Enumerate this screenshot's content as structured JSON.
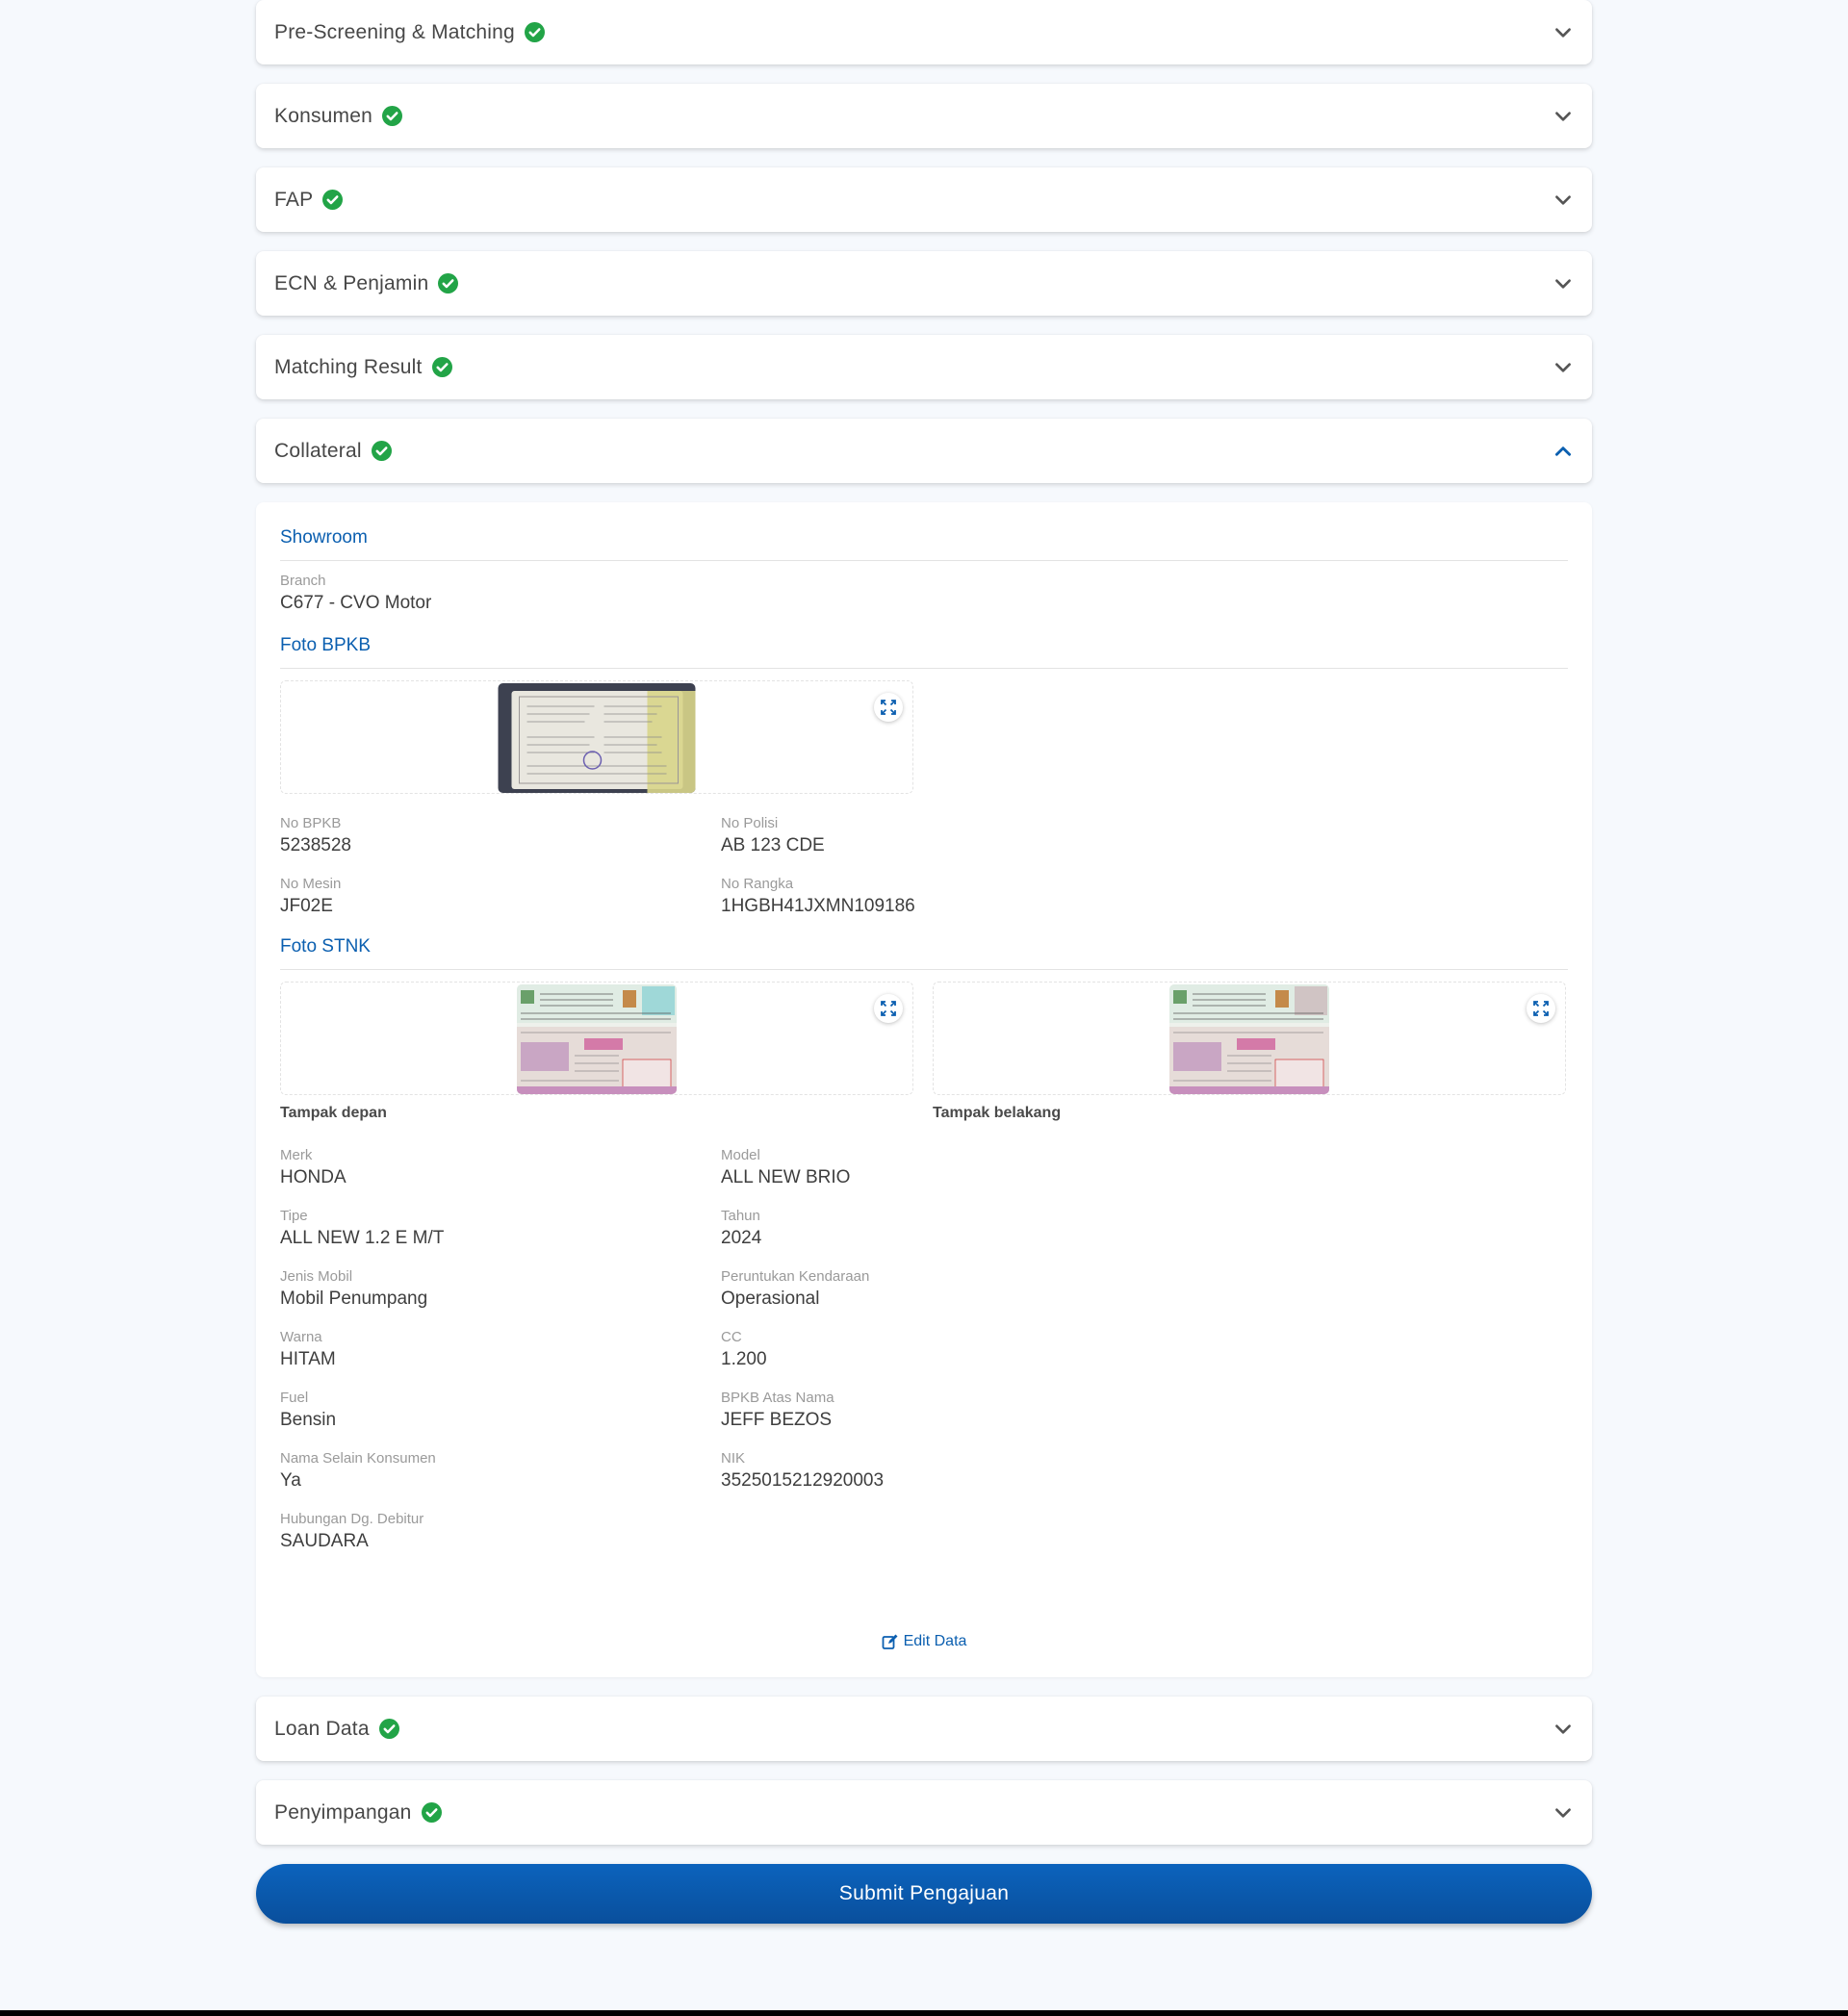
{
  "sections": {
    "prescreening": "Pre-Screening & Matching",
    "konsumen": "Konsumen",
    "fap": "FAP",
    "ecn": "ECN & Penjamin",
    "matching": "Matching Result",
    "collateral": "Collateral",
    "loan": "Loan Data",
    "penyimpangan": "Penyimpangan"
  },
  "collateral": {
    "showroom_title": "Showroom",
    "branch_label": "Branch",
    "branch_value": "C677 - CVO Motor",
    "bpkb_title": "Foto BPKB",
    "no_bpkb_label": "No BPKB",
    "no_bpkb_value": "5238528",
    "no_polisi_label": "No Polisi",
    "no_polisi_value": "AB 123 CDE",
    "no_mesin_label": "No Mesin",
    "no_mesin_value": "JF02E",
    "no_rangka_label": "No Rangka",
    "no_rangka_value": "1HGBH41JXMN109186",
    "stnk_title": "Foto STNK",
    "stnk_front_caption": "Tampak depan",
    "stnk_back_caption": "Tampak belakang",
    "merk_label": "Merk",
    "merk_value": "HONDA",
    "model_label": "Model",
    "model_value": "ALL NEW BRIO",
    "tipe_label": "Tipe",
    "tipe_value": "ALL NEW 1.2 E M/T",
    "tahun_label": "Tahun",
    "tahun_value": "2024",
    "jenis_label": "Jenis Mobil",
    "jenis_value": "Mobil Penumpang",
    "peruntukan_label": "Peruntukan Kendaraan",
    "peruntukan_value": "Operasional",
    "warna_label": "Warna",
    "warna_value": "HITAM",
    "cc_label": "CC",
    "cc_value": "1.200",
    "fuel_label": "Fuel",
    "fuel_value": "Bensin",
    "atasnama_label": "BPKB Atas Nama",
    "atasnama_value": "JEFF BEZOS",
    "selain_label": "Nama Selain Konsumen",
    "selain_value": "Ya",
    "nik_label": "NIK",
    "nik_value": "3525015212920003",
    "hubungan_label": "Hubungan Dg. Debitur",
    "hubungan_value": "SAUDARA",
    "edit_label": "Edit Data"
  },
  "submit_label": "Submit Pengajuan",
  "icons": {
    "check": "check-circle-icon",
    "chevron_down": "chevron-down-icon",
    "chevron_up": "chevron-up-icon",
    "expand": "expand-icon",
    "edit": "edit-icon"
  },
  "colors": {
    "accent": "#0b5fb0",
    "success": "#22a447",
    "background": "#f6f9fd"
  }
}
